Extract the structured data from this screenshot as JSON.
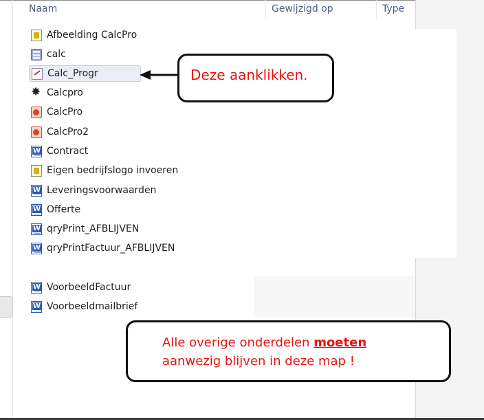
{
  "columns": {
    "name": "Naam",
    "modified": "Gewijzigd op",
    "type": "Type"
  },
  "files": [
    {
      "name": "Afbeelding CalcPro",
      "icon": "image-file-icon"
    },
    {
      "name": "calc",
      "icon": "calculator-file-icon"
    },
    {
      "name": "Calc_Progr",
      "icon": "access-database-icon",
      "selected": true
    },
    {
      "name": "Calcpro",
      "icon": "gear-file-icon"
    },
    {
      "name": "CalcPro",
      "icon": "powerpoint-file-icon"
    },
    {
      "name": "CalcPro2",
      "icon": "powerpoint-file-icon"
    },
    {
      "name": "Contract",
      "icon": "word-document-icon"
    },
    {
      "name": "Eigen bedrijfslogo invoeren",
      "icon": "image-file-icon"
    },
    {
      "name": "Leveringsvoorwaarden",
      "icon": "word-document-icon"
    },
    {
      "name": "Offerte",
      "icon": "word-document-icon"
    },
    {
      "name": "qryPrint_AFBLIJVEN",
      "icon": "word-document-icon"
    },
    {
      "name": "qryPrintFactuur_AFBLIJVEN",
      "icon": "word-document-icon"
    },
    {
      "name": "VoorbeeldFactuur",
      "icon": "word-document-icon"
    },
    {
      "name": "Voorbeeldmailbrief",
      "icon": "word-document-icon"
    }
  ],
  "callouts": {
    "click_here": "Deze aanklikken.",
    "keep_before": "Alle overige onderdelen ",
    "keep_emph": "moeten",
    "keep_after": "aanwezig blijven in deze map !"
  },
  "colors": {
    "callout_text": "#e8130f",
    "header_text": "#4d6082",
    "selection": "#e8eef7"
  }
}
